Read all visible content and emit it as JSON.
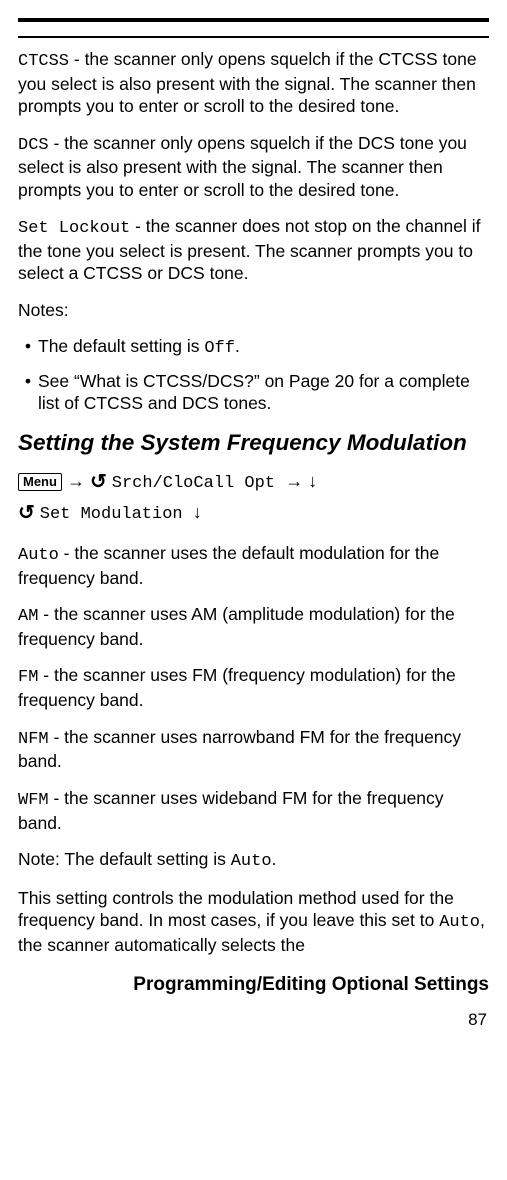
{
  "p_ctcss_code": "CTCSS",
  "p_ctcss_rest": " - the scanner only opens squelch if the CTCSS tone you select is also present with the signal. The scanner then prompts you to enter or scroll to the desired tone.",
  "p_dcs_code": "DCS",
  "p_dcs_rest": " - the scanner only opens squelch if the DCS tone you select is also present with the signal. The scanner then prompts you to enter or scroll to the desired tone.",
  "p_lock_code": "Set Lockout",
  "p_lock_rest": " - the scanner does not stop on the channel if the tone you select is present. The scanner prompts you to select a CTCSS or DCS tone.",
  "notes_label": "Notes:",
  "note1_a": "The default setting is ",
  "note1_code": "Off",
  "note1_b": ".",
  "note2": "See “What is CTCSS/DCS?” on Page 20 for a complete list of CTCSS and DCS tones.",
  "heading": "Setting the System Frequency Modulation",
  "menu_key": "Menu",
  "nav_code1": "Srch/CloCall Opt",
  "nav_code2": "Set Modulation",
  "p_auto_code": "Auto",
  "p_auto_rest": " - the scanner uses the default modulation for the frequency band.",
  "p_am_code": "AM",
  "p_am_rest": " - the scanner uses AM (amplitude modulation) for the frequency band.",
  "p_fm_code": "FM",
  "p_fm_rest": " - the scanner uses FM (frequency modulation) for the frequency band.",
  "p_nfm_code": "NFM",
  "p_nfm_rest": " - the scanner uses narrowband FM for the frequency band.",
  "p_wfm_code": "WFM",
  "p_wfm_rest": " - the scanner uses wideband FM for the frequency band.",
  "note_default_a": "Note: The default setting is ",
  "note_default_code": "Auto",
  "note_default_b": ".",
  "p_last_a": "This setting controls the modulation method used for the frequency band. In most cases, if you leave this set to ",
  "p_last_code": "Auto",
  "p_last_b": ", the scanner automatically selects the",
  "footer_title": "Programming/Editing Optional Settings",
  "page_number": "87"
}
